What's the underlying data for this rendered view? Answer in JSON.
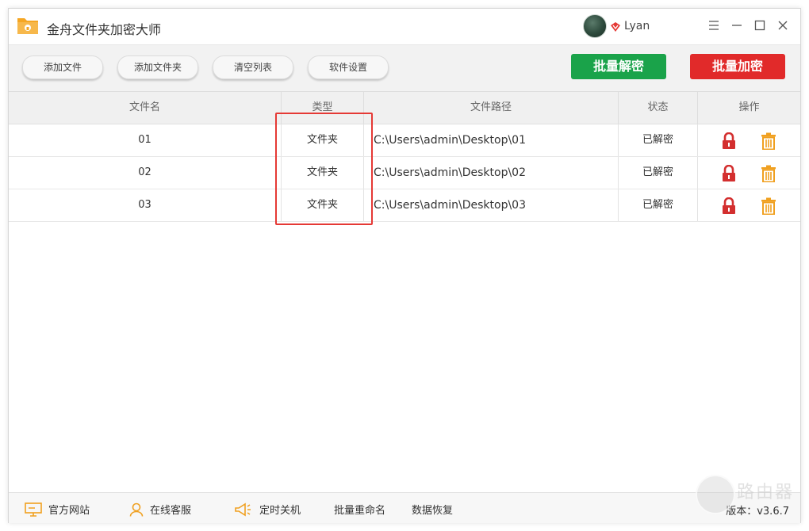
{
  "app": {
    "title": "金舟文件夹加密大师",
    "user": "Lyan"
  },
  "toolbar": {
    "add_file": "添加文件",
    "add_folder": "添加文件夹",
    "clear_list": "清空列表",
    "settings": "软件设置",
    "batch_decrypt": "批量解密",
    "batch_encrypt": "批量加密"
  },
  "table": {
    "headers": {
      "name": "文件名",
      "type": "类型",
      "path": "文件路径",
      "status": "状态",
      "ops": "操作"
    },
    "rows": [
      {
        "name": "01",
        "type": "文件夹",
        "path": "C:\\Users\\admin\\Desktop\\01",
        "status": "已解密"
      },
      {
        "name": "02",
        "type": "文件夹",
        "path": "C:\\Users\\admin\\Desktop\\02",
        "status": "已解密"
      },
      {
        "name": "03",
        "type": "文件夹",
        "path": "C:\\Users\\admin\\Desktop\\03",
        "status": "已解密"
      }
    ]
  },
  "footer": {
    "website": "官方网站",
    "support": "在线客服",
    "shutdown": "定时关机",
    "rename": "批量重命名",
    "recovery": "数据恢复",
    "version": "版本：v3.6.7"
  },
  "watermark": "路由器",
  "colors": {
    "decrypt": "#1aa34a",
    "encrypt": "#e12a2a",
    "lock": "#d32f2f",
    "trash": "#f0a020",
    "highlight": "#e53935"
  }
}
